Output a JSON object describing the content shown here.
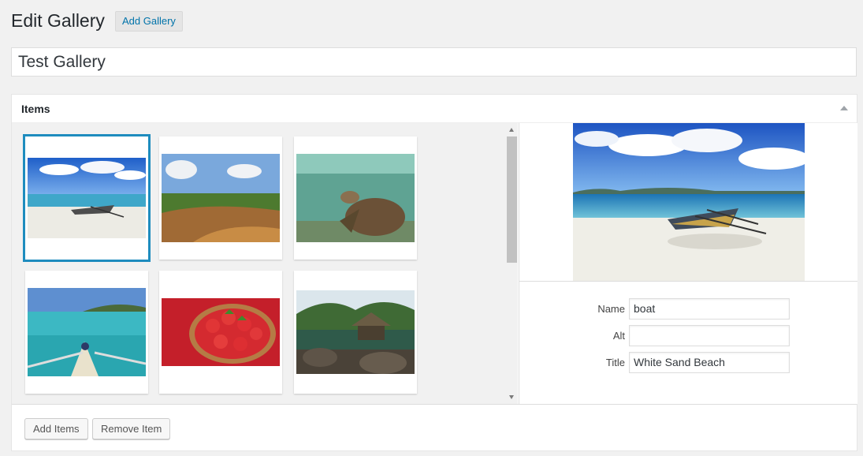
{
  "header": {
    "title": "Edit Gallery",
    "add_button": "Add Gallery"
  },
  "gallery_title_value": "Test Gallery",
  "items_box": {
    "title": "Items"
  },
  "thumbnails": [
    {
      "name": "boat",
      "selected": true
    },
    {
      "name": "hills",
      "selected": false
    },
    {
      "name": "turtle",
      "selected": false
    },
    {
      "name": "boat-bow",
      "selected": false
    },
    {
      "name": "strawberries",
      "selected": false
    },
    {
      "name": "hut",
      "selected": false
    }
  ],
  "details": {
    "name_label": "Name",
    "name_value": "boat",
    "alt_label": "Alt",
    "alt_value": "",
    "title_label": "Title",
    "title_value": "White Sand Beach"
  },
  "footer": {
    "add_items": "Add Items",
    "remove_item": "Remove Item"
  },
  "colors": {
    "accent": "#1e8cbe",
    "link": "#0073aa"
  }
}
